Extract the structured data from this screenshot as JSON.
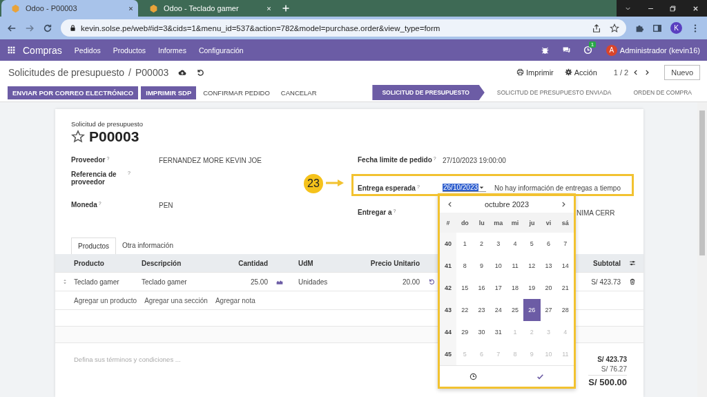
{
  "browser": {
    "tabs": [
      {
        "title": "Odoo - P00003",
        "selected": true
      },
      {
        "title": "Odoo - Teclado gamer",
        "selected": false
      }
    ],
    "url": "kevin.solse.pe/web#id=3&cids=1&menu_id=537&action=782&model=purchase.order&view_type=form",
    "profile": "K"
  },
  "navbar": {
    "app": "Compras",
    "menu": [
      "Pedidos",
      "Productos",
      "Informes",
      "Configuración"
    ],
    "activity_count": "1",
    "user_initial": "A",
    "user": "Administrador (kevin16)"
  },
  "control_panel": {
    "breadcrumb": "Solicitudes de presupuesto",
    "separator": "/",
    "current": "P00003",
    "print": "Imprimir",
    "action": "Acción",
    "pager": "1 / 2",
    "new": "Nuevo"
  },
  "actions": [
    {
      "label": "ENVIAR POR CORREO ELECTRÓNICO",
      "kind": "primary"
    },
    {
      "label": "IMPRIMIR SDP",
      "kind": "primary"
    },
    {
      "label": "CONFIRMAR PEDIDO",
      "kind": "link"
    },
    {
      "label": "CANCELAR",
      "kind": "link"
    }
  ],
  "stages": [
    {
      "label": "SOLICITUD DE PRESUPUESTO",
      "selected": true
    },
    {
      "label": "SOLICITUD DE PRESUPUESTO ENVIADA",
      "selected": false
    },
    {
      "label": "ORDEN DE COMPRA",
      "selected": false
    }
  ],
  "sheet": {
    "subtitle": "Solicitud de presupuesto",
    "name": "P00003",
    "starred": false,
    "fields_left": [
      {
        "label": "Proveedor",
        "help": "?",
        "value": "FERNANDEZ MORE KEVIN JOE"
      },
      {
        "label": "Referencia de proveedor",
        "help": "?"
      },
      {
        "label": "Moneda",
        "help": "?",
        "value": "PEN"
      }
    ],
    "fields_right": [
      {
        "label": "Fecha limite de pedido",
        "help": "?",
        "value": "27/10/2023 19:00:00",
        "kind": "text"
      },
      {
        "label": "Entrega esperada",
        "help": "?",
        "value": "26/10/2023",
        "note": "No hay información de entregas a tiempo",
        "kind": "date"
      },
      {
        "label": "Entregar a",
        "help": "?",
        "value": "NIMA CERR",
        "kind": "text"
      }
    ],
    "tabs": [
      {
        "label": "Productos",
        "selected": true
      },
      {
        "label": "Otra información",
        "selected": false
      }
    ],
    "table": {
      "columns": [
        "Producto",
        "Descripción",
        "Cantidad",
        "UdM",
        "Precio Unitario",
        "Subtotal"
      ],
      "rows": [
        {
          "product": "Teclado gamer",
          "description": "Teclado gamer",
          "quantity": "25.00",
          "uom": "Unidades",
          "unit_price": "20.00",
          "subtotal": "S/ 423.73"
        }
      ],
      "add_links": [
        "Agregar un producto",
        "Agregar una sección",
        "Agregar nota"
      ]
    },
    "terms": {
      "placeholder": "Defina sus términos y condiciones ..."
    },
    "totals": [
      "S/ 423.73",
      "S/ 76.27",
      "S/ 500.00"
    ]
  },
  "datepicker": {
    "month": "octubre 2023",
    "header": [
      "#",
      "do",
      "lu",
      "ma",
      "mi",
      "ju",
      "vi",
      "sá"
    ],
    "weeks": [
      {
        "number": "40",
        "days": [
          {
            "day": "1",
            "outside": false,
            "selected": false
          },
          {
            "day": "2",
            "outside": false,
            "selected": false
          },
          {
            "day": "3",
            "outside": false,
            "selected": false
          },
          {
            "day": "4",
            "outside": false,
            "selected": false
          },
          {
            "day": "5",
            "outside": false,
            "selected": false
          },
          {
            "day": "6",
            "outside": false,
            "selected": false
          },
          {
            "day": "7",
            "outside": false,
            "selected": false
          }
        ]
      },
      {
        "number": "41",
        "days": [
          {
            "day": "8",
            "outside": false,
            "selected": false
          },
          {
            "day": "9",
            "outside": false,
            "selected": false
          },
          {
            "day": "10",
            "outside": false,
            "selected": false
          },
          {
            "day": "11",
            "outside": false,
            "selected": false
          },
          {
            "day": "12",
            "outside": false,
            "selected": false
          },
          {
            "day": "13",
            "outside": false,
            "selected": false
          },
          {
            "day": "14",
            "outside": false,
            "selected": false
          }
        ]
      },
      {
        "number": "42",
        "days": [
          {
            "day": "15",
            "outside": false,
            "selected": false
          },
          {
            "day": "16",
            "outside": false,
            "selected": false
          },
          {
            "day": "17",
            "outside": false,
            "selected": false
          },
          {
            "day": "18",
            "outside": false,
            "selected": false
          },
          {
            "day": "19",
            "outside": false,
            "selected": false
          },
          {
            "day": "20",
            "outside": false,
            "selected": false
          },
          {
            "day": "21",
            "outside": false,
            "selected": false
          }
        ]
      },
      {
        "number": "43",
        "days": [
          {
            "day": "22",
            "outside": false,
            "selected": false
          },
          {
            "day": "23",
            "outside": false,
            "selected": false
          },
          {
            "day": "24",
            "outside": false,
            "selected": false
          },
          {
            "day": "25",
            "outside": false,
            "selected": false
          },
          {
            "day": "26",
            "outside": false,
            "selected": true
          },
          {
            "day": "27",
            "outside": false,
            "selected": false
          },
          {
            "day": "28",
            "outside": false,
            "selected": false
          }
        ]
      },
      {
        "number": "44",
        "days": [
          {
            "day": "29",
            "outside": false,
            "selected": false
          },
          {
            "day": "30",
            "outside": false,
            "selected": false
          },
          {
            "day": "31",
            "outside": false,
            "selected": false
          },
          {
            "day": "1",
            "outside": true,
            "selected": false
          },
          {
            "day": "2",
            "outside": true,
            "selected": false
          },
          {
            "day": "3",
            "outside": true,
            "selected": false
          },
          {
            "day": "4",
            "outside": true,
            "selected": false
          }
        ]
      },
      {
        "number": "45",
        "days": [
          {
            "day": "5",
            "outside": true,
            "selected": false
          },
          {
            "day": "6",
            "outside": true,
            "selected": false
          },
          {
            "day": "7",
            "outside": true,
            "selected": false
          },
          {
            "day": "8",
            "outside": true,
            "selected": false
          },
          {
            "day": "9",
            "outside": true,
            "selected": false
          },
          {
            "day": "10",
            "outside": true,
            "selected": false
          },
          {
            "day": "11",
            "outside": true,
            "selected": false
          }
        ]
      }
    ]
  },
  "annotation": {
    "number": "23"
  }
}
